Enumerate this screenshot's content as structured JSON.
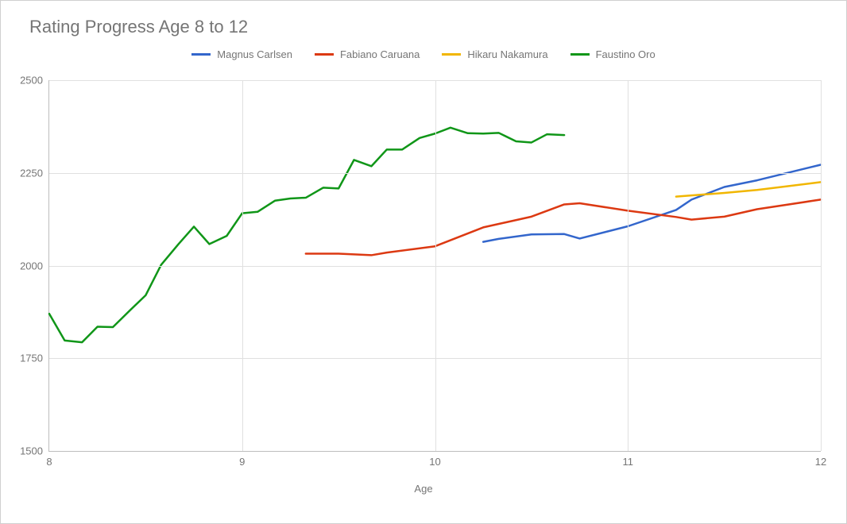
{
  "chart_data": {
    "type": "line",
    "title": "Rating Progress Age 8 to 12",
    "xlabel": "Age",
    "ylabel": "",
    "xlim": [
      8,
      12
    ],
    "ylim": [
      1500,
      2500
    ],
    "x_ticks": [
      8,
      9,
      10,
      11,
      12
    ],
    "y_ticks": [
      1500,
      1750,
      2000,
      2250,
      2500
    ],
    "series": [
      {
        "name": "Magnus Carlsen",
        "color": "#3366cc",
        "x": [
          10.25,
          10.33,
          10.5,
          10.67,
          10.75,
          11.0,
          11.25,
          11.33,
          11.5,
          11.67,
          12.0
        ],
        "values": [
          2064,
          2072,
          2084,
          2085,
          2073,
          2106,
          2150,
          2178,
          2212,
          2230,
          2272
        ]
      },
      {
        "name": "Fabiano Caruana",
        "color": "#dc3912",
        "x": [
          9.33,
          9.5,
          9.67,
          9.75,
          10.0,
          10.25,
          10.5,
          10.67,
          10.75,
          11.0,
          11.25,
          11.33,
          11.5,
          11.67,
          12.0
        ],
        "values": [
          2032,
          2032,
          2028,
          2035,
          2052,
          2103,
          2132,
          2165,
          2168,
          2148,
          2131,
          2124,
          2132,
          2152,
          2178
        ]
      },
      {
        "name": "Hikaru Nakamura",
        "color": "#f1b600",
        "x": [
          11.25,
          11.5,
          11.67,
          12.0
        ],
        "values": [
          2186,
          2196,
          2204,
          2225
        ]
      },
      {
        "name": "Faustino Oro",
        "color": "#109618",
        "x": [
          8.0,
          8.08,
          8.17,
          8.25,
          8.33,
          8.42,
          8.5,
          8.58,
          8.67,
          8.75,
          8.83,
          8.92,
          9.0,
          9.08,
          9.17,
          9.25,
          9.33,
          9.42,
          9.5,
          9.58,
          9.67,
          9.75,
          9.83,
          9.92,
          10.0,
          10.08,
          10.17,
          10.25,
          10.33,
          10.42,
          10.5,
          10.58,
          10.67
        ],
        "values": [
          1870,
          1798,
          1793,
          1835,
          1834,
          1880,
          1920,
          2002,
          2058,
          2105,
          2058,
          2080,
          2141,
          2145,
          2175,
          2181,
          2183,
          2210,
          2208,
          2285,
          2268,
          2313,
          2313,
          2344,
          2356,
          2372,
          2357,
          2356,
          2358,
          2335,
          2332,
          2354,
          2352
        ]
      }
    ]
  }
}
